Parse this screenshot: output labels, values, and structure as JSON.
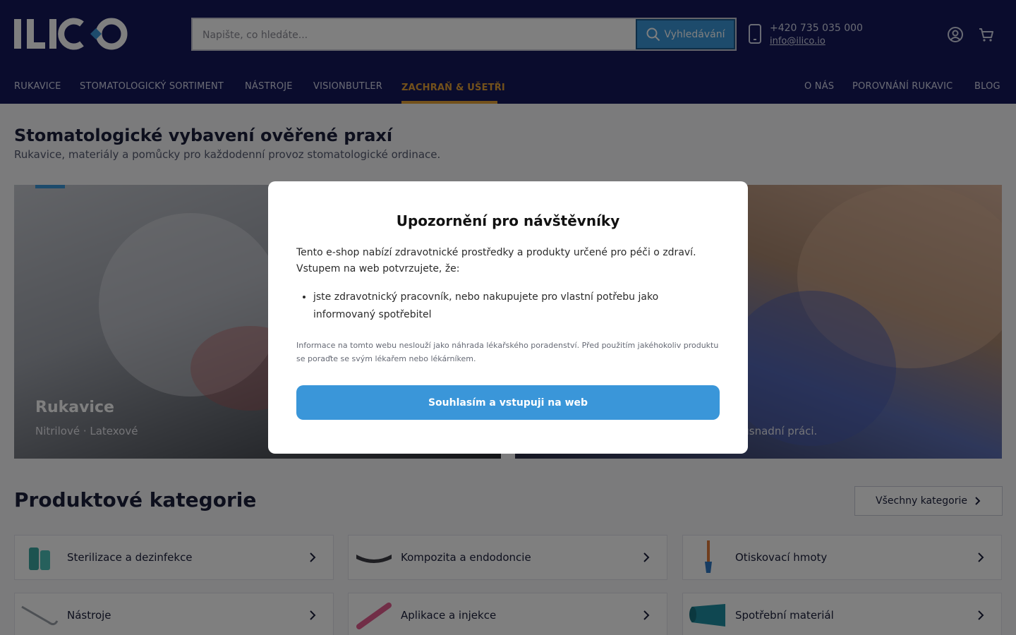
{
  "brand": {
    "logo_text": "ILICO",
    "accent": "#3a96d9",
    "header_bg": "#15185a",
    "highlight": "#e7a337"
  },
  "header": {
    "search_placeholder": "Napište, co hledáte...",
    "search_button": "Vyhledávání",
    "phone": "+420 735 035 000",
    "email": "info@ilico.io",
    "icons": [
      "search-icon",
      "phone-icon",
      "account-icon",
      "cart-icon"
    ]
  },
  "nav": {
    "left": [
      "RUKAVICE",
      "STOMATOLOGICKÝ SORTIMENT",
      "NÁSTROJE",
      "VISIONBUTLER"
    ],
    "highlight": "ZACHRAŇ & UŠETŘI",
    "right": [
      "O NÁS",
      "POROVNÁNÍ RUKAVIC",
      "BLOG"
    ]
  },
  "main": {
    "title": "Stomatologické vybavení ověřené praxí",
    "subtitle": "Rukavice, materiály a pomůcky pro každodenní provoz stomatologické ordinace.",
    "hero_left": {
      "title": "Rukavice",
      "subtitle": "Nitrilové · Latexové"
    },
    "hero_right": {
      "subtitle_fragment": "n usnadní práci."
    },
    "categories_title": "Produktové kategorie",
    "all_categories": "Všechny kategorie",
    "categories": [
      "Sterilizace a dezinfekce",
      "Kompozita a endodoncie",
      "Otiskovací hmoty",
      "Nástroje",
      "Aplikace a injekce",
      "Spotřební materiál"
    ]
  },
  "modal": {
    "title": "Upozornění pro návštěvníky",
    "text": "Tento e-shop nabízí zdravotnické prostředky a produkty určené pro péči o zdraví. Vstupem na web potvrzujete, že:",
    "list_item": "jste zdravotnický pracovník, nebo nakupujete pro vlastní potřebu jako informovaný spotřebitel",
    "note": "Informace na tomto webu neslouží jako náhrada lékařského poradenství. Před použitím jakéhokoliv produktu se poraďte se svým lékařem nebo lékárníkem.",
    "button": "Souhlasím a vstupuji na web"
  }
}
